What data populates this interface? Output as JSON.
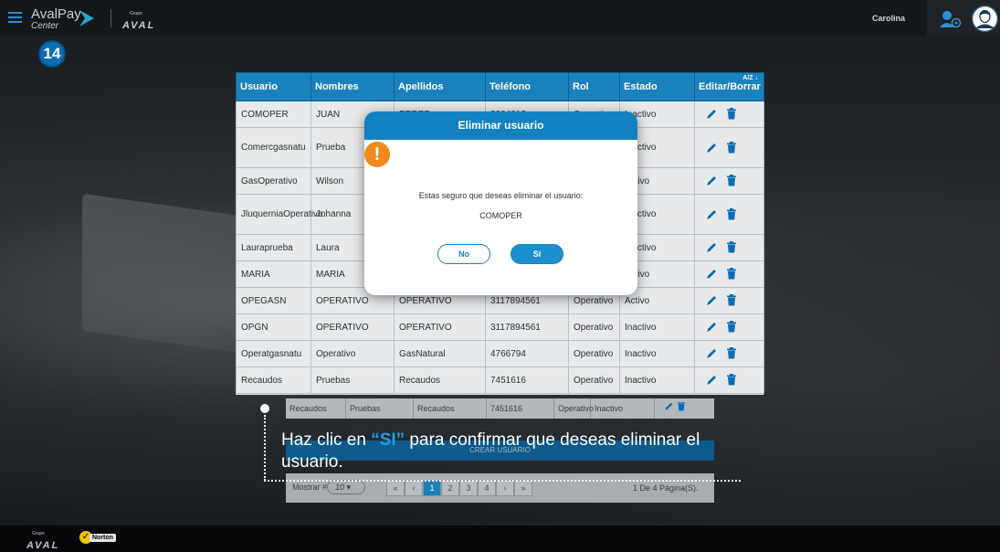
{
  "header": {
    "logo_primary": "AvalPay",
    "logo_secondary": "Center",
    "group_prefix": "Grupo",
    "group_name": "AVAL",
    "user_name": "Carolina"
  },
  "step": "14",
  "table": {
    "columns": [
      "Usuario",
      "Nombres",
      "Apellidos",
      "Teléfono",
      "Rol",
      "Estado",
      "Editar/Borrar"
    ],
    "sort_indicator": "A/Z ↓",
    "rows": [
      {
        "usuario": "COMOPER",
        "nombres": "JUAN",
        "apellidos": "PEREZ",
        "telefono": "3004812",
        "rol": "Operativo",
        "estado": "Inactivo"
      },
      {
        "usuario": "Comercgasnatu",
        "nombres": "Prueba",
        "apellidos": "",
        "telefono": "",
        "rol": "",
        "estado": "Inactivo"
      },
      {
        "usuario": "GasOperativo",
        "nombres": "Wilson",
        "apellidos": "",
        "telefono": "",
        "rol": "",
        "estado": "Activo"
      },
      {
        "usuario": "JluquerniaOperativo",
        "nombres": "Johanna",
        "apellidos": "",
        "telefono": "",
        "rol": "",
        "estado": "Inactivo"
      },
      {
        "usuario": "Lauraprueba",
        "nombres": "Laura",
        "apellidos": "",
        "telefono": "",
        "rol": "",
        "estado": "Inactivo"
      },
      {
        "usuario": "MARIA",
        "nombres": "MARIA",
        "apellidos": "",
        "telefono": "",
        "rol": "",
        "estado": "Activo"
      },
      {
        "usuario": "OPEGASN",
        "nombres": "OPERATIVO",
        "apellidos": "OPERATIVO",
        "telefono": "3117894561",
        "rol": "Operativo",
        "estado": "Activo"
      },
      {
        "usuario": "OPGN",
        "nombres": "OPERATIVO",
        "apellidos": "OPERATIVO",
        "telefono": "3117894561",
        "rol": "Operativo",
        "estado": "Inactivo"
      },
      {
        "usuario": "Operatgasnatu",
        "nombres": "Operativo",
        "apellidos": "GasNatural",
        "telefono": "4766794",
        "rol": "Operativo",
        "estado": "Inactivo"
      },
      {
        "usuario": "Recaudos",
        "nombres": "Pruebas",
        "apellidos": "Recaudos",
        "telefono": "7451616",
        "rol": "Operativo",
        "estado": "Inactivo"
      }
    ]
  },
  "modal": {
    "title": "Eliminar usuario",
    "warning_glyph": "!",
    "message": "Estas seguro que deseas eliminar el usuario:",
    "target_user": "COMOPER",
    "no_label": "No",
    "si_label": "Sí"
  },
  "ghost": {
    "row": [
      "Recaudos",
      "Pruebas",
      "Recaudos",
      "7451616",
      "Operativo",
      "Inactivo"
    ],
    "create_label": "CREAR USUARIO",
    "mostrar_label": "Mostrar #",
    "page_size": "10",
    "pages": [
      "1",
      "2",
      "3",
      "4"
    ],
    "page_info": "1 De 4 Página(S)."
  },
  "instruction": {
    "before": "Haz clic en ",
    "highlight": "“SI”",
    "after": " para confirmar que deseas eliminar el usuario."
  },
  "footer": {
    "group_prefix": "Grupo",
    "group_name": "AVAL",
    "norton": "Norton"
  },
  "colors": {
    "primary": "#1381c1",
    "header_bg": "#141719",
    "warning": "#f08a1c",
    "highlight": "#1aa0e8"
  }
}
